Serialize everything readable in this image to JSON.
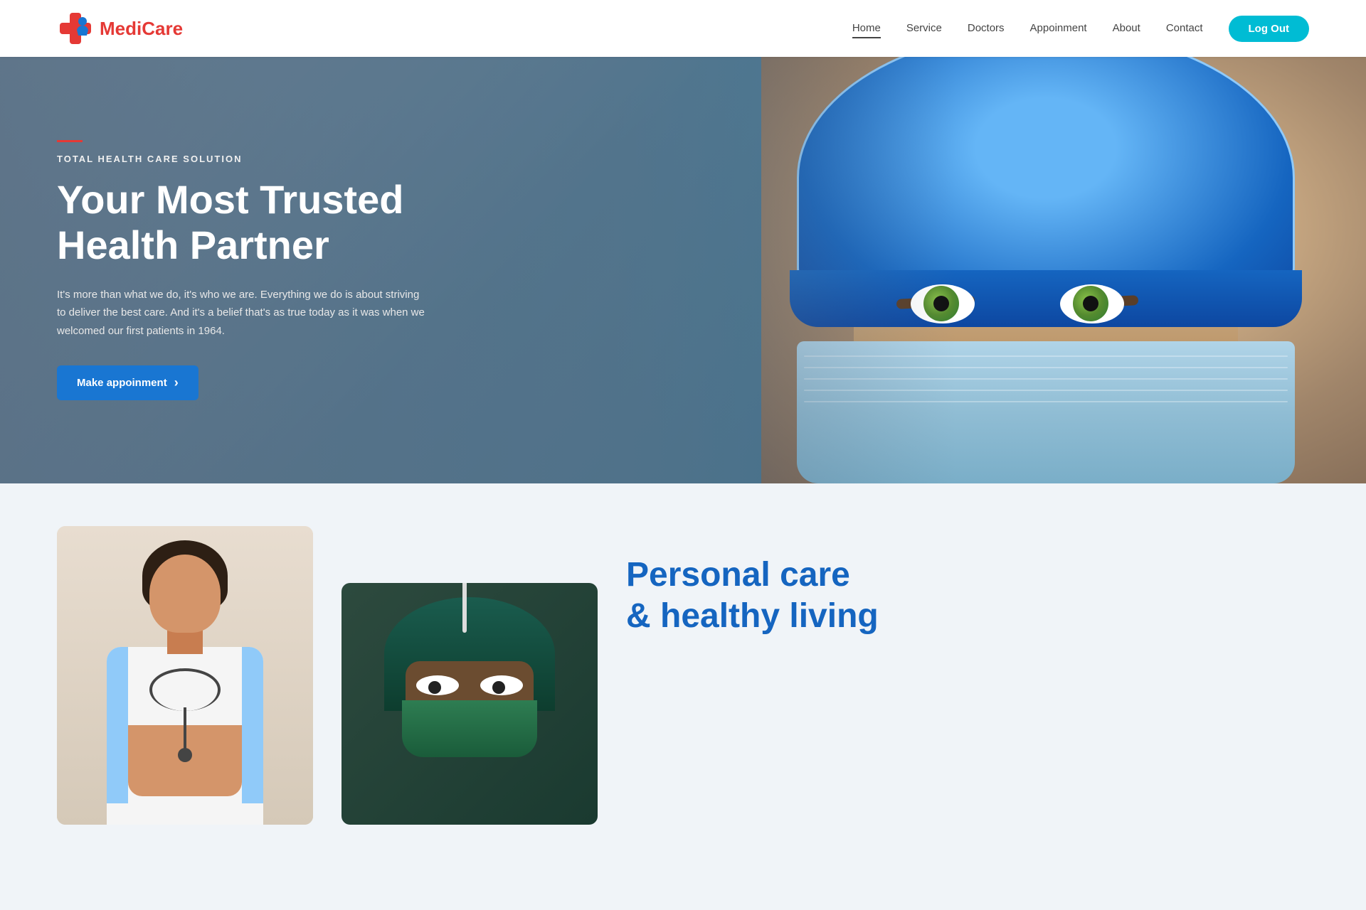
{
  "brand": {
    "name_part1": "Medi",
    "name_part2": "Care"
  },
  "navbar": {
    "links": [
      {
        "id": "home",
        "label": "Home",
        "active": true
      },
      {
        "id": "service",
        "label": "Service",
        "active": false
      },
      {
        "id": "doctors",
        "label": "Doctors",
        "active": false
      },
      {
        "id": "appoinment",
        "label": "Appoinment",
        "active": false
      },
      {
        "id": "about",
        "label": "About",
        "active": false
      },
      {
        "id": "contact",
        "label": "Contact",
        "active": false
      }
    ],
    "logout_label": "Log Out"
  },
  "hero": {
    "tag": "TOTAL HEALTH CARE SOLUTION",
    "title": "Your Most Trusted Health Partner",
    "description": "It's more than what we do, it's who we are. Everything we do is about striving to deliver the best care. And it's a belief that's as true today as it was when we welcomed our first patients in 1964.",
    "cta_label": "Make appoinment"
  },
  "section_below": {
    "personal_care_line1": "Personal care",
    "personal_care_line2": "& healthy living"
  }
}
